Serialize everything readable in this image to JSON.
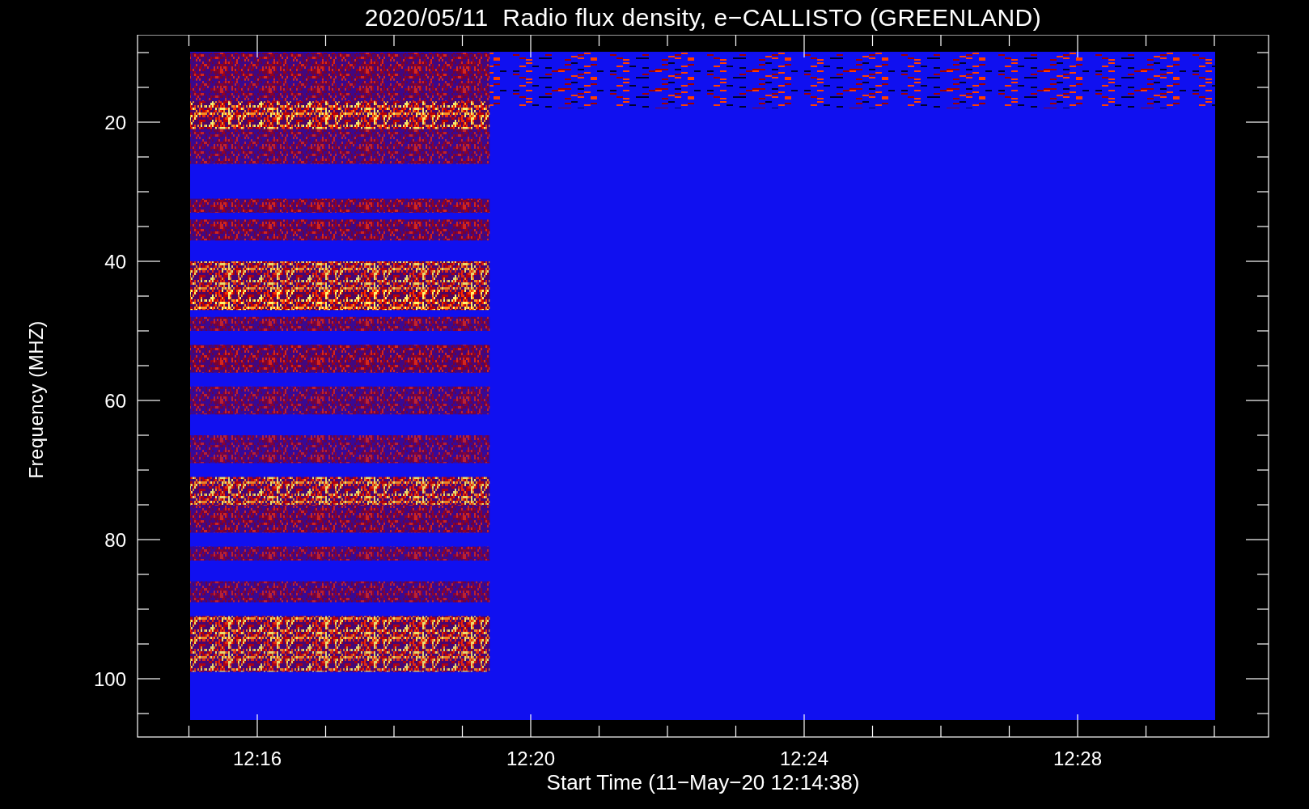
{
  "title": "2020/05/11  Radio flux density, e−CALLISTO (GREENLAND)",
  "y_axis": {
    "title": "Frequency (MHZ)",
    "ticks": [
      "20",
      "40",
      "60",
      "80",
      "100"
    ]
  },
  "x_axis": {
    "title": "Start Time (11−May−20 12:14:38)",
    "ticks": [
      "12:16",
      "12:20",
      "12:24",
      "12:28"
    ]
  }
}
